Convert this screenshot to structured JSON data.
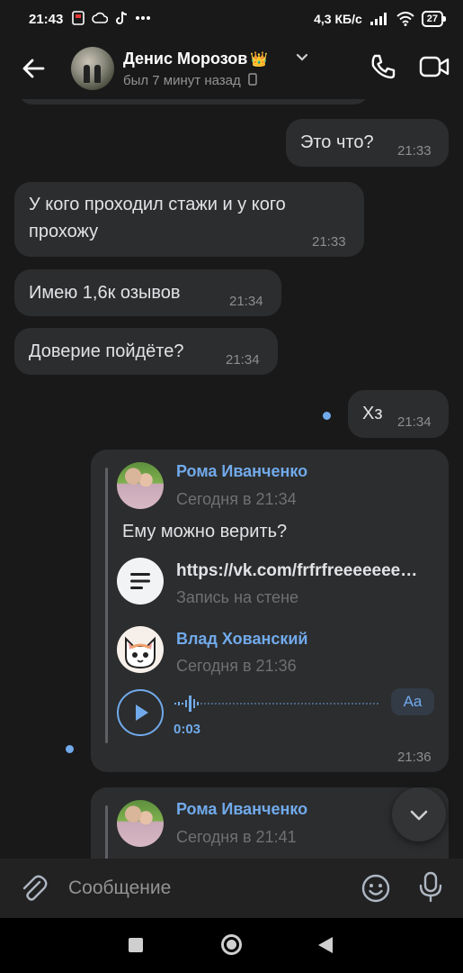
{
  "status_bar": {
    "time": "21:43",
    "left_icons": [
      "notification-icon",
      "cloud-icon",
      "tiktok-icon",
      "more-dots-icon"
    ],
    "network_speed": "4,3 КБ/с",
    "battery": "27"
  },
  "header": {
    "contact_name": "Денис Морозов",
    "badge_emoji": "👑",
    "last_seen": "был 7 минут назад"
  },
  "messages": [
    {
      "side": "out",
      "text": "Это что?",
      "time": "21:33"
    },
    {
      "side": "in",
      "text": "У кого проходил стажи и у кого прохожу",
      "time": "21:33"
    },
    {
      "side": "in",
      "text": "Имею 1,6к озывов",
      "time": "21:34"
    },
    {
      "side": "in",
      "text": "Доверие пойдёте?",
      "time": "21:34"
    },
    {
      "side": "out",
      "text": "Хз",
      "time": "21:34"
    }
  ],
  "forwarded": {
    "time": "21:36",
    "author": "Рома Иванченко",
    "date": "Сегодня в 21:34",
    "text": "Ему можно верить?",
    "link_url": "https://vk.com/frfrfreeeeeee…",
    "link_subtitle": "Запись на стене",
    "nested_author": "Влад Хованский",
    "nested_date": "Сегодня в 21:36",
    "voice_duration": "0:03",
    "transcribe_label": "Aa"
  },
  "forwarded_2": {
    "author": "Рома Иванченко",
    "date": "Сегодня в 21:41"
  },
  "composer": {
    "placeholder": "Сообщение"
  },
  "colors": {
    "background": "#19191a",
    "bubble": "#2c2d2e",
    "accent": "#71aaeb"
  }
}
